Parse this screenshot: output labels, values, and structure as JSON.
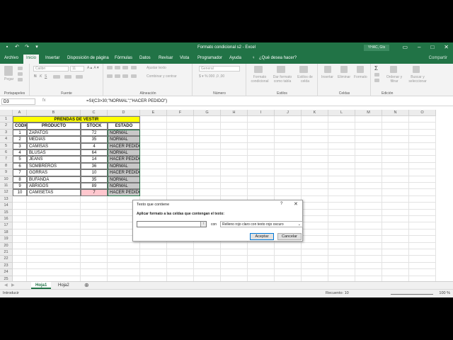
{
  "window": {
    "title": "Formato condicional s2  -  Excel",
    "user": "YHAC, Gts"
  },
  "tabs": [
    "Archivo",
    "Inicio",
    "Insertar",
    "Disposición de página",
    "Fórmulas",
    "Datos",
    "Revisar",
    "Vista",
    "Programador",
    "Ayuda",
    "¿Qué desea hacer?"
  ],
  "share_label": "Compartir",
  "ribbon": {
    "groups": [
      "Portapapeles",
      "Fuente",
      "Alineación",
      "Número",
      "Estilos",
      "Celdas",
      "Edición"
    ],
    "font_name": "Calibri",
    "font_size": "11",
    "number_format": "General",
    "paste": "Pegar",
    "wrap": "Ajustar texto",
    "merge": "Combinar y centrar",
    "cond_format": "Formato condicional",
    "format_table": "Dar formato como tabla",
    "cell_styles": "Estilos de celda",
    "insert": "Insertar",
    "delete": "Eliminar",
    "format": "Formato",
    "sort": "Ordenar y filtrar",
    "find": "Buscar y seleccionar"
  },
  "formula_bar": {
    "name_box": "D3",
    "fx": "fx",
    "formula": "=SI(C3>30;\"NORMAL\";\"HACER PEDIDO\")"
  },
  "columns": [
    "A",
    "B",
    "C",
    "D",
    "E",
    "F",
    "G",
    "H",
    "I",
    "J",
    "K",
    "L",
    "M",
    "N",
    "O"
  ],
  "rows": [
    "1",
    "2",
    "3",
    "4",
    "5",
    "6",
    "7",
    "8",
    "9",
    "10",
    "11",
    "12",
    "13",
    "14",
    "15",
    "16",
    "17",
    "18",
    "19",
    "20",
    "21",
    "22",
    "23",
    "24",
    "25",
    "26"
  ],
  "table": {
    "title": "PRENDAS DE VESTIR",
    "headers": [
      "CODIGO",
      "PRODUCTO",
      "STOCK",
      "ESTADO"
    ],
    "rows": [
      [
        "1",
        "ZAPATOS",
        "72",
        "NORMAL"
      ],
      [
        "2",
        "MEDIAS",
        "35",
        "NORMAL"
      ],
      [
        "3",
        "CAMISAS",
        "4",
        "HACER PEDIDO"
      ],
      [
        "4",
        "BLUSAS",
        "64",
        "NORMAL"
      ],
      [
        "5",
        "JEANS",
        "14",
        "HACER PEDIDO"
      ],
      [
        "6",
        "SOMBREROS",
        "36",
        "NORMAL"
      ],
      [
        "7",
        "GORRAS",
        "10",
        "HACER PEDIDO"
      ],
      [
        "8",
        "BUFANDA",
        "35",
        "NORMAL"
      ],
      [
        "9",
        "ABRIGOS",
        "89",
        "NORMAL"
      ],
      [
        "10",
        "CAMISETAS",
        "7",
        "HACER PEDIDO"
      ]
    ]
  },
  "colors": {
    "excel_green": "#217346",
    "title_fill": "#ffff00",
    "selection_fill": "#c8c8c8",
    "highlight_fill": "#ffc7ce"
  },
  "dialog": {
    "title": "Texto que contiene",
    "help": "?",
    "close": "✕",
    "label": "Aplicar formato a las celdas que contengan el texto:",
    "input_value": "",
    "con": "con",
    "format_option": "Relleno rojo claro con texto rojo oscuro",
    "accept": "Aceptar",
    "cancel": "Cancelar"
  },
  "sheets": [
    "Hoja1",
    "Hoja2"
  ],
  "status": {
    "mode": "Introducir",
    "count": "Recuento: 10",
    "zoom": "100 %"
  }
}
